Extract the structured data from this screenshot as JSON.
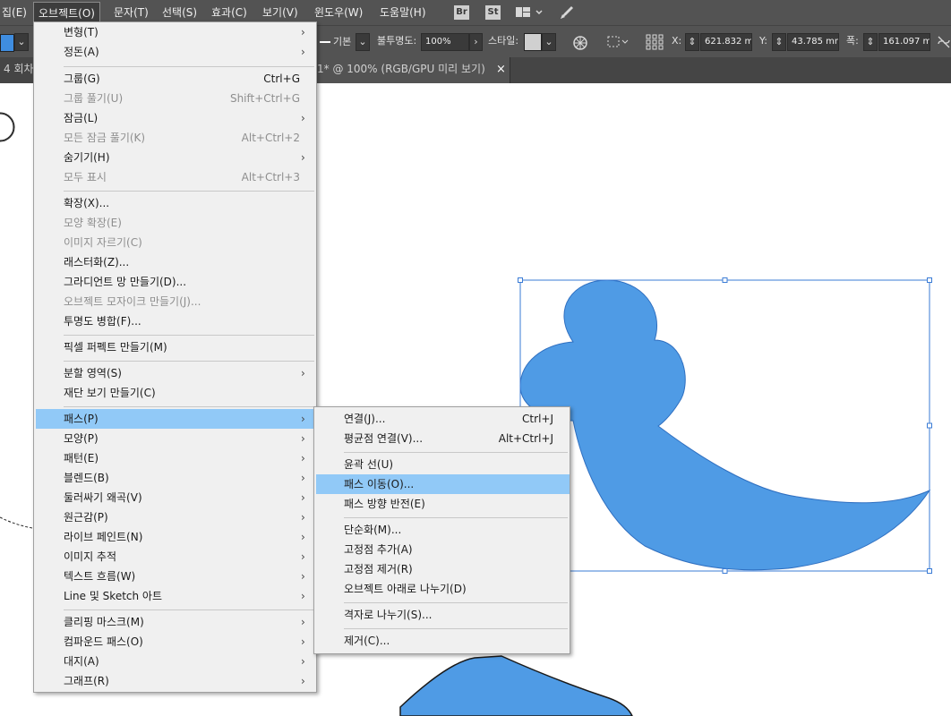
{
  "menubar": {
    "items": [
      "집(E)",
      "오브젝트(O)",
      "문자(T)",
      "선택(S)",
      "효과(C)",
      "보기(V)",
      "윈도우(W)",
      "도움말(H)"
    ],
    "icons": [
      "Br",
      "St"
    ]
  },
  "controlbar": {
    "stroke_style": "기본",
    "opacity_label": "불투명도:",
    "opacity_value": "100%",
    "style_label": "스타일:",
    "x_label": "X:",
    "x_value": "621.832 m",
    "y_label": "Y:",
    "y_value": "43.785 mm",
    "w_label": "폭:",
    "w_value": "161.097 m"
  },
  "tabs": {
    "left_partial": "4 회차",
    "active_title": "1* @ 100% (RGB/GPU 미리 보기)",
    "close": "×"
  },
  "object_menu": {
    "items": [
      {
        "label": "변형(T)",
        "shortcut": "",
        "submenu": true,
        "disabled": false
      },
      {
        "label": "정돈(A)",
        "shortcut": "",
        "submenu": true,
        "disabled": false
      },
      {
        "label": "그룹(G)",
        "shortcut": "Ctrl+G",
        "submenu": false,
        "disabled": false
      },
      {
        "label": "그룹 풀기(U)",
        "shortcut": "Shift+Ctrl+G",
        "submenu": false,
        "disabled": true
      },
      {
        "label": "잠금(L)",
        "shortcut": "",
        "submenu": true,
        "disabled": false
      },
      {
        "label": "모든 잠금 풀기(K)",
        "shortcut": "Alt+Ctrl+2",
        "submenu": false,
        "disabled": true
      },
      {
        "label": "숨기기(H)",
        "shortcut": "",
        "submenu": true,
        "disabled": false
      },
      {
        "label": "모두 표시",
        "shortcut": "Alt+Ctrl+3",
        "submenu": false,
        "disabled": true
      },
      {
        "label": "확장(X)...",
        "shortcut": "",
        "submenu": false,
        "disabled": false
      },
      {
        "label": "모양 확장(E)",
        "shortcut": "",
        "submenu": false,
        "disabled": true
      },
      {
        "label": "이미지 자르기(C)",
        "shortcut": "",
        "submenu": false,
        "disabled": true
      },
      {
        "label": "래스터화(Z)...",
        "shortcut": "",
        "submenu": false,
        "disabled": false
      },
      {
        "label": "그라디언트 망 만들기(D)...",
        "shortcut": "",
        "submenu": false,
        "disabled": false
      },
      {
        "label": "오브젝트 모자이크 만들기(J)...",
        "shortcut": "",
        "submenu": false,
        "disabled": true
      },
      {
        "label": "투명도 병합(F)...",
        "shortcut": "",
        "submenu": false,
        "disabled": false
      },
      {
        "label": "픽셀 퍼펙트 만들기(M)",
        "shortcut": "",
        "submenu": false,
        "disabled": false
      },
      {
        "label": "분할 영역(S)",
        "shortcut": "",
        "submenu": true,
        "disabled": false
      },
      {
        "label": "재단 보기 만들기(C)",
        "shortcut": "",
        "submenu": false,
        "disabled": false
      },
      {
        "label": "패스(P)",
        "shortcut": "",
        "submenu": true,
        "disabled": false,
        "highlighted": true
      },
      {
        "label": "모양(P)",
        "shortcut": "",
        "submenu": true,
        "disabled": false
      },
      {
        "label": "패턴(E)",
        "shortcut": "",
        "submenu": true,
        "disabled": false
      },
      {
        "label": "블렌드(B)",
        "shortcut": "",
        "submenu": true,
        "disabled": false
      },
      {
        "label": "둘러싸기 왜곡(V)",
        "shortcut": "",
        "submenu": true,
        "disabled": false
      },
      {
        "label": "원근감(P)",
        "shortcut": "",
        "submenu": true,
        "disabled": false
      },
      {
        "label": "라이브 페인트(N)",
        "shortcut": "",
        "submenu": true,
        "disabled": false
      },
      {
        "label": "이미지 추적",
        "shortcut": "",
        "submenu": true,
        "disabled": false
      },
      {
        "label": "텍스트 흐름(W)",
        "shortcut": "",
        "submenu": true,
        "disabled": false
      },
      {
        "label": "Line 및 Sketch 아트",
        "shortcut": "",
        "submenu": true,
        "disabled": false
      },
      {
        "label": "클리핑 마스크(M)",
        "shortcut": "",
        "submenu": true,
        "disabled": false
      },
      {
        "label": "컴파운드 패스(O)",
        "shortcut": "",
        "submenu": true,
        "disabled": false
      },
      {
        "label": "대지(A)",
        "shortcut": "",
        "submenu": true,
        "disabled": false
      },
      {
        "label": "그래프(R)",
        "shortcut": "",
        "submenu": true,
        "disabled": false
      }
    ]
  },
  "path_submenu": {
    "items": [
      {
        "label": "연결(J)...",
        "shortcut": "Ctrl+J"
      },
      {
        "label": "평균점 연결(V)...",
        "shortcut": "Alt+Ctrl+J"
      },
      {
        "label": "윤곽 선(U)",
        "shortcut": ""
      },
      {
        "label": "패스 이동(O)...",
        "shortcut": "",
        "highlighted": true
      },
      {
        "label": "패스 방향 반전(E)",
        "shortcut": ""
      },
      {
        "label": "단순화(M)...",
        "shortcut": ""
      },
      {
        "label": "고정점 추가(A)",
        "shortcut": ""
      },
      {
        "label": "고정점 제거(R)",
        "shortcut": ""
      },
      {
        "label": "오브젝트 아래로 나누기(D)",
        "shortcut": ""
      },
      {
        "label": "격자로 나누기(S)...",
        "shortcut": ""
      },
      {
        "label": "제거(C)...",
        "shortcut": ""
      }
    ]
  },
  "colors": {
    "menu_bg": "#f0f0f0",
    "highlight": "#91c9f7",
    "shape_fill": "#4f9be5",
    "selection": "#3a7bd5",
    "chrome": "#535353"
  }
}
